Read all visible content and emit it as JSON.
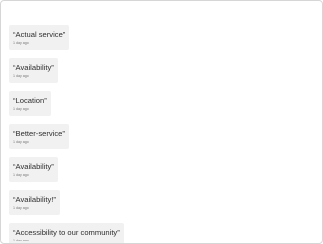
{
  "comments": [
    {
      "text": "“Actual service”",
      "time": "1 day ago"
    },
    {
      "text": "“Availability”",
      "time": "1 day ago"
    },
    {
      "text": "“Location”",
      "time": "1 day ago"
    },
    {
      "text": "“Better-service”",
      "time": "1 day ago"
    },
    {
      "text": "“Availability”",
      "time": "1 day ago"
    },
    {
      "text": "“Availability!”",
      "time": "1 day ago"
    },
    {
      "text": "“Accessibility to our community”",
      "time": "1 day ago"
    }
  ]
}
